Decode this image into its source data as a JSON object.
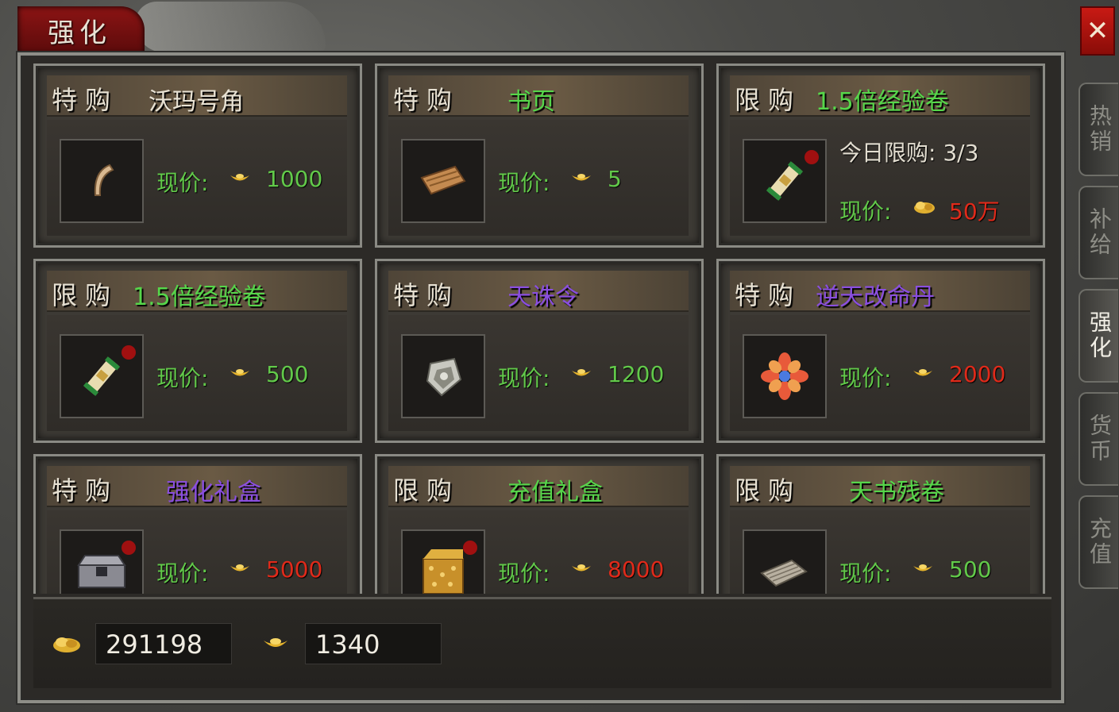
{
  "window": {
    "title": "强化",
    "close_label": "✕"
  },
  "side_tabs": [
    {
      "label": "热销",
      "active": false
    },
    {
      "label": "补给",
      "active": false
    },
    {
      "label": "强化",
      "active": true
    },
    {
      "label": "货币",
      "active": false
    },
    {
      "label": "充值",
      "active": false
    }
  ],
  "items": [
    {
      "tag": "特购",
      "name": "沃玛号角",
      "name_color": "#e8e2d4",
      "price_label": "现价:",
      "price": "1000",
      "price_color": "#62c94a",
      "currency": "gold-ingot",
      "icon": "horn-icon",
      "dot": false
    },
    {
      "tag": "特购",
      "name": "书页",
      "name_color": "#56d64a",
      "price_label": "现价:",
      "price": "5",
      "price_color": "#62c94a",
      "currency": "gold-ingot",
      "icon": "scroll-page-icon",
      "dot": false
    },
    {
      "tag": "限购",
      "name": "1.5倍经验卷",
      "name_color": "#56d64a",
      "limit_text": "今日限购: 3/3",
      "price_label": "现价:",
      "price": "50万",
      "price_color": "#e02a1a",
      "currency": "gold-nugget",
      "icon": "exp-scroll-icon",
      "dot": true
    },
    {
      "tag": "限购",
      "name": "1.5倍经验卷",
      "name_color": "#56d64a",
      "price_label": "现价:",
      "price": "500",
      "price_color": "#62c94a",
      "currency": "gold-ingot",
      "icon": "exp-scroll-icon",
      "dot": true
    },
    {
      "tag": "特购",
      "name": "天诛令",
      "name_color": "#8a4ee0",
      "price_label": "现价:",
      "price": "1200",
      "price_color": "#62c94a",
      "currency": "gold-ingot",
      "icon": "shield-token-icon",
      "dot": false
    },
    {
      "tag": "特购",
      "name": "逆天改命丹",
      "name_color": "#8a4ee0",
      "price_label": "现价:",
      "price": "2000",
      "price_color": "#e02a1a",
      "currency": "gold-ingot",
      "icon": "flower-pill-icon",
      "dot": false
    },
    {
      "tag": "特购",
      "name": "强化礼盒",
      "name_color": "#8a4ee0",
      "price_label": "现价:",
      "price": "5000",
      "price_color": "#e02a1a",
      "currency": "gold-ingot",
      "icon": "chest-icon",
      "dot": true
    },
    {
      "tag": "限购",
      "name": "充值礼盒",
      "name_color": "#56d64a",
      "price_label": "现价:",
      "price": "8000",
      "price_color": "#e02a1a",
      "currency": "gold-ingot",
      "icon": "gold-box-icon",
      "dot": true
    },
    {
      "tag": "限购",
      "name": "天书残卷",
      "name_color": "#56d64a",
      "price_label": "现价:",
      "price": "500",
      "price_color": "#62c94a",
      "currency": "gold-ingot",
      "icon": "tome-scroll-icon",
      "dot": false
    }
  ],
  "footer": {
    "gold_amount": "291198",
    "ingot_amount": "1340"
  }
}
